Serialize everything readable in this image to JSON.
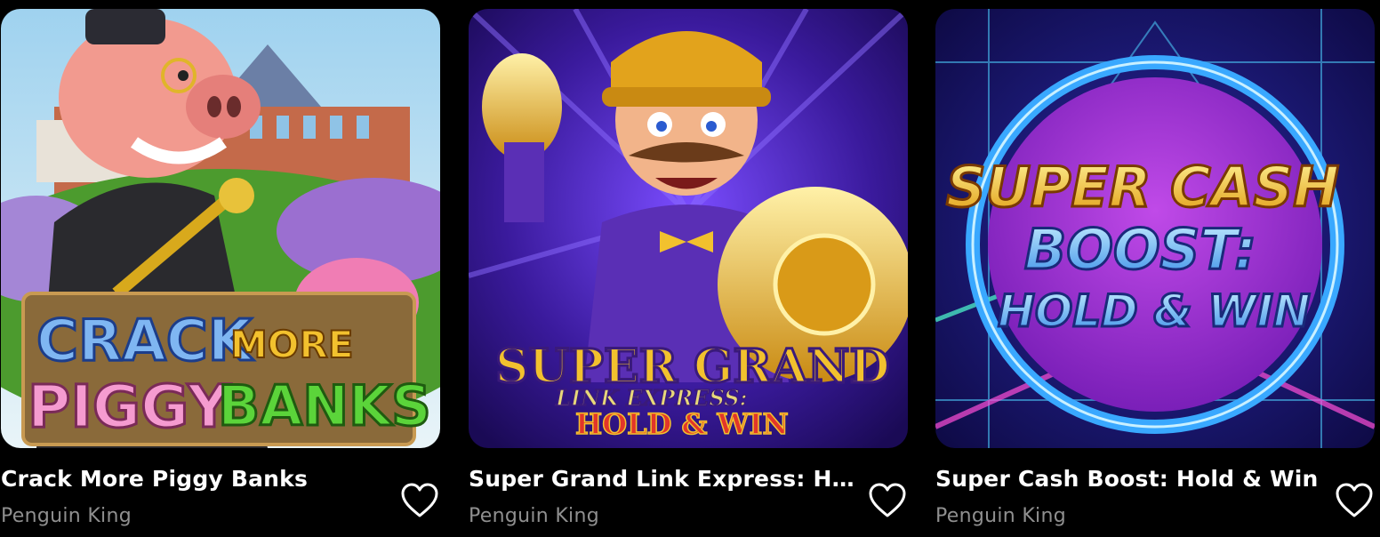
{
  "games": [
    {
      "title": "Crack More Piggy Banks",
      "provider": "Penguin King",
      "art": {
        "line1": "CRACK",
        "line2": "MORE",
        "line3": "PIGGY",
        "line4": "BANKS"
      },
      "colors": {
        "sky": "#bfe0f2",
        "accent": "#f07db4",
        "green": "#3fbf2a"
      }
    },
    {
      "title": "Super Grand Link Express: Ho...",
      "provider": "Penguin King",
      "art": {
        "line1": "SUPER GRAND",
        "line2": "LINK EXPRESS:",
        "line3": "HOLD & WIN"
      },
      "colors": {
        "bg": "#3a1a9c",
        "gold": "#f2c12e",
        "purple": "#5a2fb5"
      }
    },
    {
      "title": "Super Cash Boost: Hold & Win",
      "provider": "Penguin King",
      "art": {
        "line1": "SUPER CASH",
        "line2": "BOOST:",
        "line3": "HOLD & WIN"
      },
      "colors": {
        "bg": "#1a1160",
        "ring": "#39a8ff",
        "disc": "#9a32d9"
      }
    }
  ],
  "icons": {
    "favorite": "heart-outline-icon"
  }
}
